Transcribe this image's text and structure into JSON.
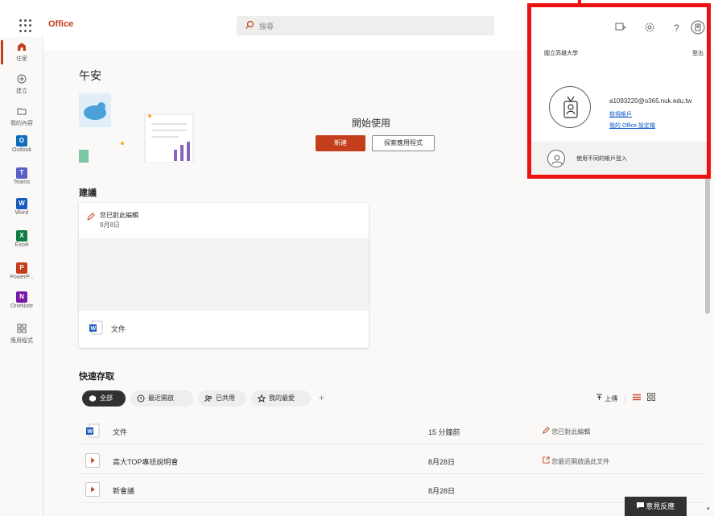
{
  "header": {
    "brand": "Office",
    "search_placeholder": "搜尋"
  },
  "rail": {
    "items": [
      {
        "label": "住家"
      },
      {
        "label": "建立"
      },
      {
        "label": "我的內容"
      },
      {
        "label": "Outlook"
      },
      {
        "label": "Teams"
      },
      {
        "label": "Word"
      },
      {
        "label": "Excel"
      },
      {
        "label": "PowerP..."
      },
      {
        "label": "OneNote"
      },
      {
        "label": "應用程式"
      }
    ]
  },
  "main": {
    "greeting": "午安",
    "start_label": "開始使用",
    "new_button": "新建",
    "explore_button": "探索應用程式",
    "suggested_title": "建議",
    "suggested_card": {
      "activity": "您已對此編輯",
      "date": "9月8日",
      "doc_name": "文件"
    },
    "quick_access_title": "快速存取",
    "filters": [
      {
        "label": "全部",
        "active": true
      },
      {
        "label": "最近開啟",
        "active": false
      },
      {
        "label": "已共用",
        "active": false
      },
      {
        "label": "我的最愛",
        "active": false
      }
    ],
    "add_filter": "+",
    "upload_label": "上傳",
    "files": [
      {
        "name": "文件",
        "time": "15 分鐘前",
        "activity": "您已對此編輯",
        "icon": "word-icon"
      },
      {
        "name": "高大TOP專班說明會",
        "time": "8月28日",
        "activity": "您最近開啟過此文件",
        "icon": "video-icon"
      },
      {
        "name": "新會議",
        "time": "8月28日",
        "activity": "",
        "icon": "video-icon"
      }
    ],
    "feedback": "意見反應"
  },
  "account_panel": {
    "org": "國立高雄大學",
    "sign_out": "登出",
    "email": "a1093220@o365.nuk.edu.tw",
    "view_account": "檢視帳戶",
    "office_settings": "我的 Office 設定檔",
    "other_account": "使用不同的帳戶登入",
    "highlight_color": "#ee1111"
  },
  "colors": {
    "accent": "#c43e1c",
    "link": "#0b59c9"
  }
}
